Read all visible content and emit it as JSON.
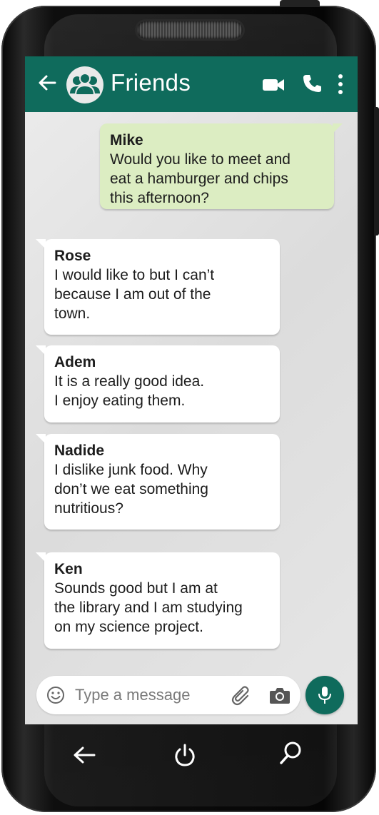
{
  "header": {
    "title": "Friends"
  },
  "messages": [
    {
      "sender": "Mike",
      "text": "Would you like to meet and\neat a hamburger and chips\nthis afternoon?",
      "direction": "outgoing"
    },
    {
      "sender": "Rose",
      "text": "I would like to but I can’t\nbecause I am out of the\ntown.",
      "direction": "incoming"
    },
    {
      "sender": "Adem",
      "text": "It is a really good idea.\nI enjoy eating them.",
      "direction": "incoming"
    },
    {
      "sender": "Nadide",
      "text": "I dislike junk food. Why\ndon’t we eat something\nnutritious?",
      "direction": "incoming"
    },
    {
      "sender": "Ken",
      "text": "Sounds good but I am at\nthe library and I am studying\non my science project.",
      "direction": "incoming"
    }
  ],
  "composer": {
    "placeholder": "Type a message"
  },
  "icons": {
    "header": [
      "back-arrow-icon",
      "group-avatar-icon",
      "video-call-icon",
      "phone-call-icon",
      "more-options-icon"
    ],
    "composer": [
      "emoji-icon",
      "attachment-icon",
      "camera-icon",
      "microphone-icon"
    ],
    "navigation": [
      "back-icon",
      "power-icon",
      "search-icon"
    ]
  },
  "colors": {
    "header_bg": "#0f6b5c",
    "outgoing_bubble": "#dcedc2",
    "incoming_bubble": "#ffffff",
    "mic_button": "#0f6b5c"
  }
}
